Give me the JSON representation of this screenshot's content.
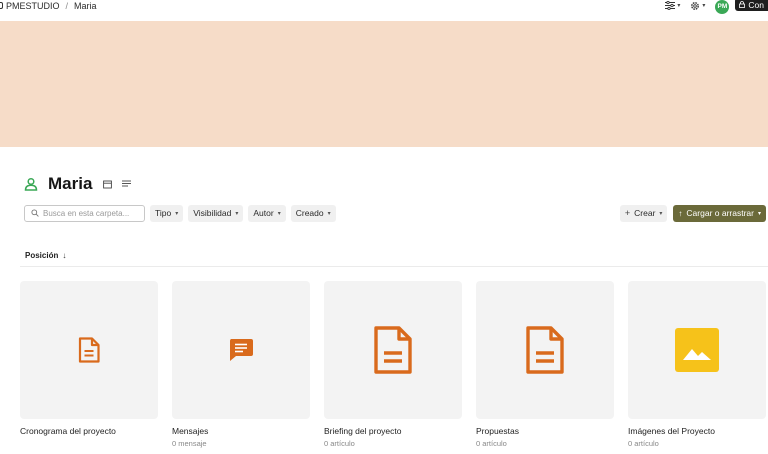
{
  "breadcrumb": {
    "workspace": "PMESTUDIO",
    "separator": "/",
    "current": "Maria"
  },
  "topbar": {
    "filter_icon": "sliders-icon",
    "settings_icon": "gear-icon",
    "avatar_initials": "PM",
    "avatar_color": "#3aa856",
    "share_label": "Con"
  },
  "banner": {
    "color": "#f6dcc8"
  },
  "page": {
    "title": "Maria"
  },
  "filters": {
    "search_placeholder": "Busca en esta carpeta...",
    "chips": [
      "Tipo",
      "Visibilidad",
      "Autor",
      "Creado"
    ]
  },
  "actions": {
    "create_label": "Crear",
    "upload_label": "Cargar o arrastrar",
    "upload_color": "#6b6a3a"
  },
  "sort": {
    "label": "Posición"
  },
  "cards": [
    {
      "title": "Cronograma del proyecto",
      "subtitle": "",
      "icon": "document-icon"
    },
    {
      "title": "Mensajes",
      "subtitle": "0 mensaje",
      "icon": "chat-icon"
    },
    {
      "title": "Briefing del proyecto",
      "subtitle": "0 artículo",
      "icon": "document-icon"
    },
    {
      "title": "Propuestas",
      "subtitle": "0 artículo",
      "icon": "document-icon"
    },
    {
      "title": "Imágenes del Proyecto",
      "subtitle": "0 artículo",
      "icon": "image-icon"
    }
  ],
  "colors": {
    "accent_orange": "#d96a1c",
    "accent_yellow": "#f6c21a",
    "accent_green": "#3aa856"
  }
}
